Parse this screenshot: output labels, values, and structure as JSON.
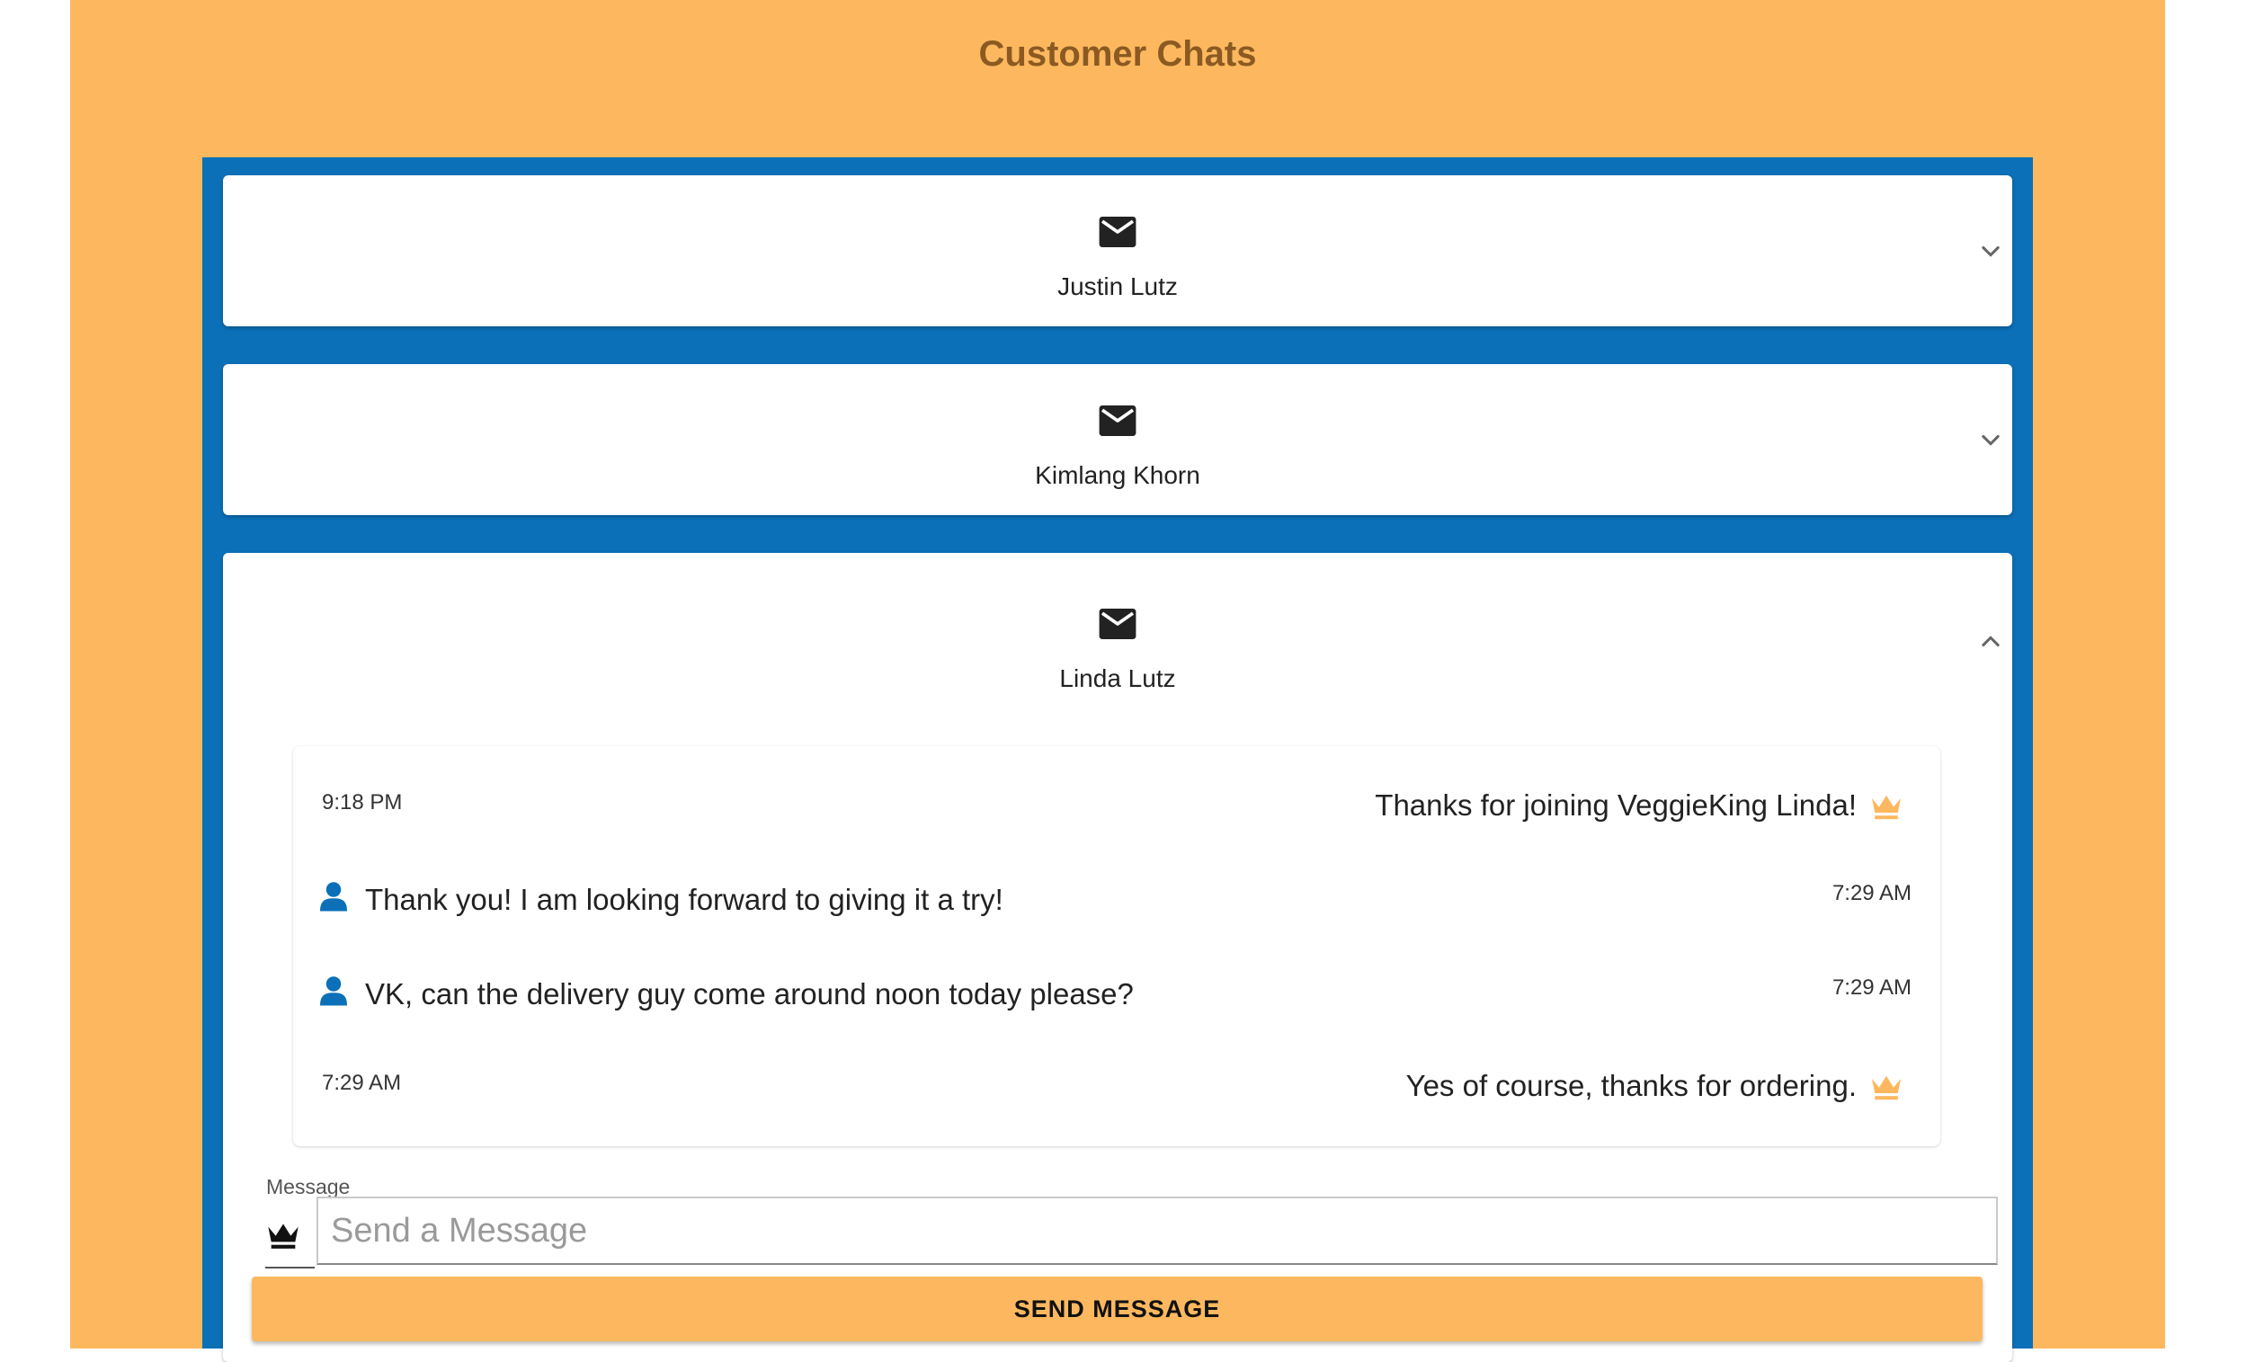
{
  "page": {
    "title": "Customer Chats"
  },
  "chats": [
    {
      "name": "Justin Lutz",
      "icon": "mail-icon",
      "expanded": false
    },
    {
      "name": "Kimlang Khorn",
      "icon": "mail-icon",
      "expanded": false
    },
    {
      "name": "Linda Lutz",
      "icon": "mail-icon",
      "expanded": true
    }
  ],
  "conversation": {
    "messages": [
      {
        "sender": "store",
        "icon": "crown-icon",
        "time": "9:18 PM",
        "text": "Thanks for joining VeggieKing Linda!"
      },
      {
        "sender": "customer",
        "icon": "person-icon",
        "time": "7:29 AM",
        "text": "Thank you! I am looking forward to giving it a try!"
      },
      {
        "sender": "customer",
        "icon": "person-icon",
        "time": "7:29 AM",
        "text": "VK, can the delivery guy come around noon today please?"
      },
      {
        "sender": "store",
        "icon": "crown-icon",
        "time": "7:29 AM",
        "text": "Yes of course, thanks for ordering."
      }
    ]
  },
  "composer": {
    "label": "Message",
    "placeholder": "Send a Message",
    "value": "",
    "send_label": "SEND MESSAGE",
    "icon": "crown-icon"
  },
  "colors": {
    "background": "#fdb85f",
    "panel": "#0b70b8",
    "title": "#8a5a22",
    "accent": "#fdb85f",
    "person": "#0b70b8"
  }
}
